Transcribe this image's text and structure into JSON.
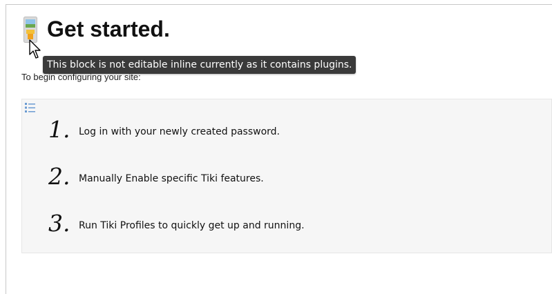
{
  "page": {
    "title": "Get started.",
    "intro": "To begin configuring your site:",
    "tooltip": "This block is not editable inline currently as it contains plugins."
  },
  "icons": {
    "header": "tiki-edit-icon",
    "cursor": "mouse-pointer-icon",
    "list": "list-plugin-icon"
  },
  "steps": [
    {
      "number": "1.",
      "text": "Log in with your newly created password."
    },
    {
      "number": "2.",
      "text": "Manually Enable specific Tiki features."
    },
    {
      "number": "3.",
      "text": "Run Tiki Profiles to quickly get up and running."
    }
  ],
  "colors": {
    "tooltip_bg": "#3a3a3a",
    "box_bg": "#f6f6f6"
  }
}
